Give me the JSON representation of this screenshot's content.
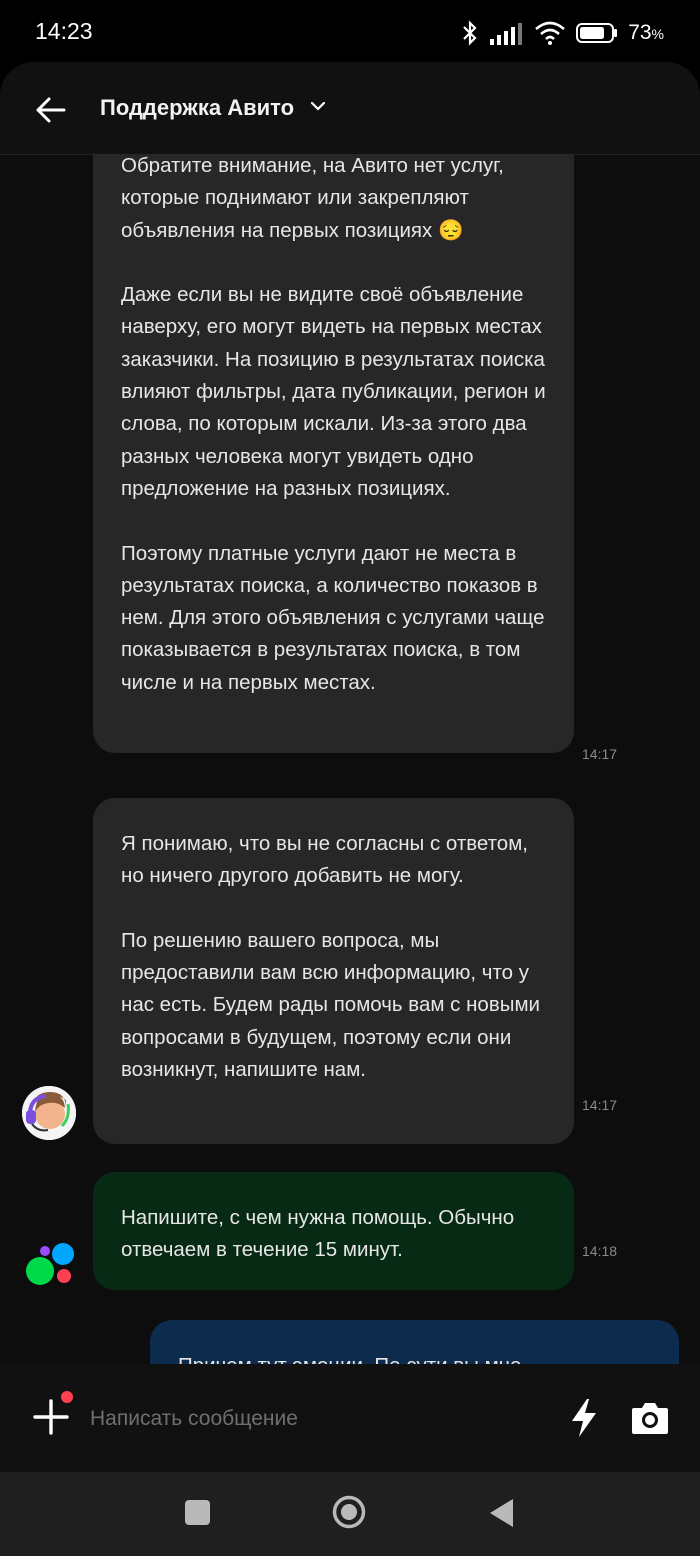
{
  "status_bar": {
    "time": "14:23",
    "battery": "73",
    "battery_unit": "%"
  },
  "header": {
    "title": "Поддержка Авито"
  },
  "messages": [
    {
      "paragraphs": [
        "Обратите внимание, на Авито нет услуг, которые поднимают или закрепляют объявления на первых позициях 😔",
        "Даже если вы не видите своё объявление наверху, его могут видеть на первых местах заказчики. На позицию в результатах поиска влияют фильтры, дата публикации, регион и слова, по которым искали. Из-за этого два разных человека могут увидеть одно предложение на разных позициях.",
        "Поэтому платные услуги дают не места в результатах поиска, а количество показов в нем. Для этого объявления с услугами чаще показывается в результатах поиска, в том числе и на первых местах."
      ],
      "time": "14:17"
    },
    {
      "paragraphs": [
        "Я понимаю, что вы не согласны с ответом, но ничего другого добавить не могу.",
        "По решению вашего вопроса, мы предоставили вам всю информацию, что у нас есть. Будем рады помочь вам с новыми вопросами в будущем, поэтому если они возникнут, напишите нам."
      ],
      "time": "14:17"
    },
    {
      "paragraphs": [
        "Напишите, с чем нужна помощь. Обычно отвечаем в течение 15 минут."
      ],
      "time": "14:18"
    },
    {
      "paragraphs": [
        "Причем тут эмоции. По сути вы мне"
      ]
    }
  ],
  "input": {
    "placeholder": "Написать сообщение"
  },
  "icons": {
    "back": "arrow-left-icon",
    "dropdown": "chevron-down-icon",
    "attach": "plus-icon",
    "quick_reply": "lightning-icon",
    "camera": "camera-icon"
  },
  "colors": {
    "support_bubble": "#272727",
    "bot_bubble": "#072a14",
    "user_bubble": "#0d2b4c",
    "notification_dot": "#ff4053"
  }
}
